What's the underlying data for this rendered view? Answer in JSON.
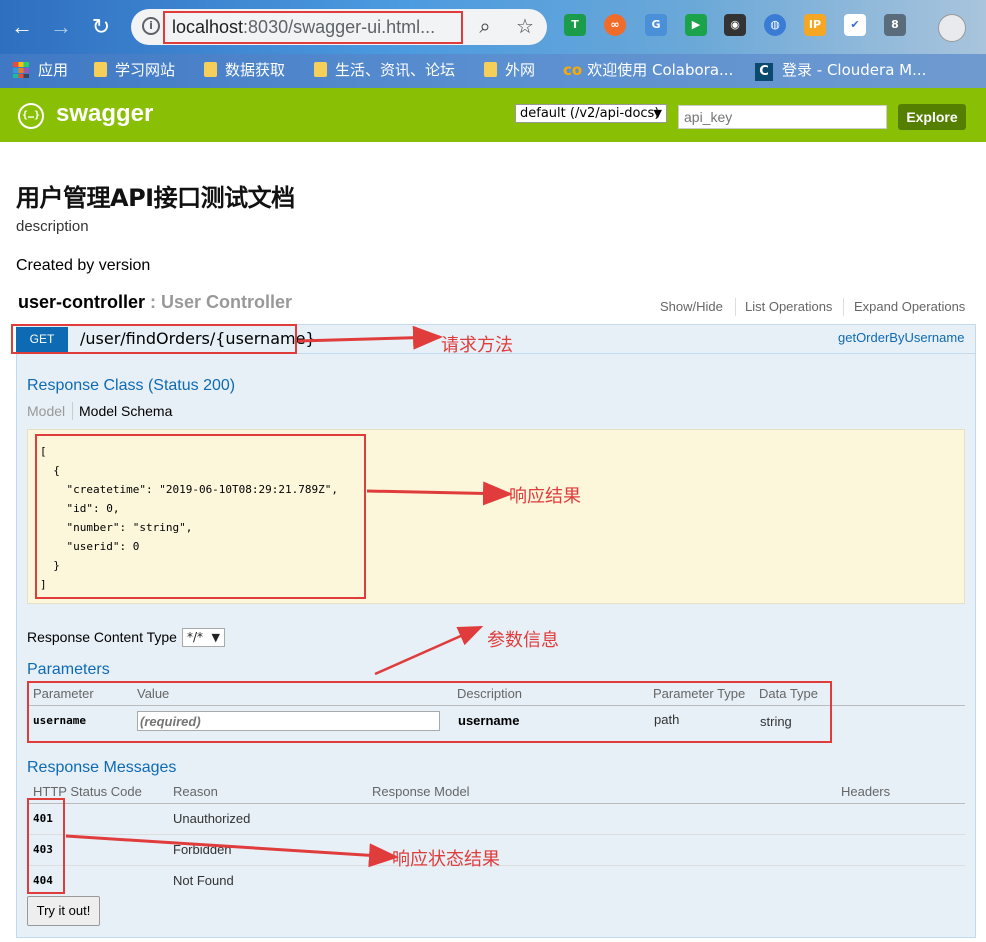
{
  "browser": {
    "url_host": "localhost",
    "url_rest": ":8030/swagger-ui.html...",
    "extensions": [
      "translate-extension-icon",
      "shield-extension-icon",
      "ip-extension-icon"
    ]
  },
  "bookmarks": [
    {
      "label": "应用",
      "icon": "apps-icon"
    },
    {
      "label": "学习网站",
      "icon": "folder-icon"
    },
    {
      "label": "数据获取",
      "icon": "folder-icon"
    },
    {
      "label": "生活、资讯、论坛",
      "icon": "folder-icon"
    },
    {
      "label": "外网",
      "icon": "folder-icon"
    },
    {
      "label": "欢迎使用 Colabora...",
      "icon": "colab-icon"
    },
    {
      "label": "登录 - Cloudera M...",
      "icon": "cloudera-icon"
    }
  ],
  "swagger": {
    "logo_text": "swagger",
    "spec_select": "default (/v2/api-docs)",
    "api_key_placeholder": "api_key",
    "explore_label": "Explore"
  },
  "info": {
    "title": "用户管理API接口测试文档",
    "description": "description",
    "created_by": "Created by version"
  },
  "controller": {
    "name": "user-controller",
    "description": " : User Controller",
    "links": [
      "Show/Hide",
      "List Operations",
      "Expand Operations"
    ]
  },
  "operation": {
    "method": "GET",
    "path": "/user/findOrders/{username}",
    "nickname": "getOrderByUsername",
    "response_class_title": "Response Class (Status 200)",
    "tab_model": "Model",
    "tab_schema": "Model Schema",
    "schema_json": "[\n  {\n    \"createtime\": \"2019-06-10T08:29:21.789Z\",\n    \"id\": 0,\n    \"number\": \"string\",\n    \"userid\": 0\n  }\n]",
    "response_content_type_label": "Response Content Type",
    "response_content_type_value": "*/*",
    "parameters_title": "Parameters",
    "param_headers": [
      "Parameter",
      "Value",
      "Description",
      "Parameter Type",
      "Data Type"
    ],
    "params": [
      {
        "name": "username",
        "placeholder": "(required)",
        "description": "username",
        "param_type": "path",
        "data_type": "string"
      }
    ],
    "response_messages_title": "Response Messages",
    "response_headers": [
      "HTTP Status Code",
      "Reason",
      "Response Model",
      "Headers"
    ],
    "responses": [
      {
        "code": "401",
        "reason": "Unauthorized"
      },
      {
        "code": "403",
        "reason": "Forbidden"
      },
      {
        "code": "404",
        "reason": "Not Found"
      }
    ],
    "try_label": "Try it out!"
  },
  "annotations": {
    "request_method": "请求方法",
    "response_result": "响应结果",
    "param_info": "参数信息",
    "response_status": "响应状态结果"
  },
  "colors": {
    "swagger_green": "#89bf04",
    "get_blue": "#0f6ab4",
    "annotation_red": "#e03c3c"
  }
}
